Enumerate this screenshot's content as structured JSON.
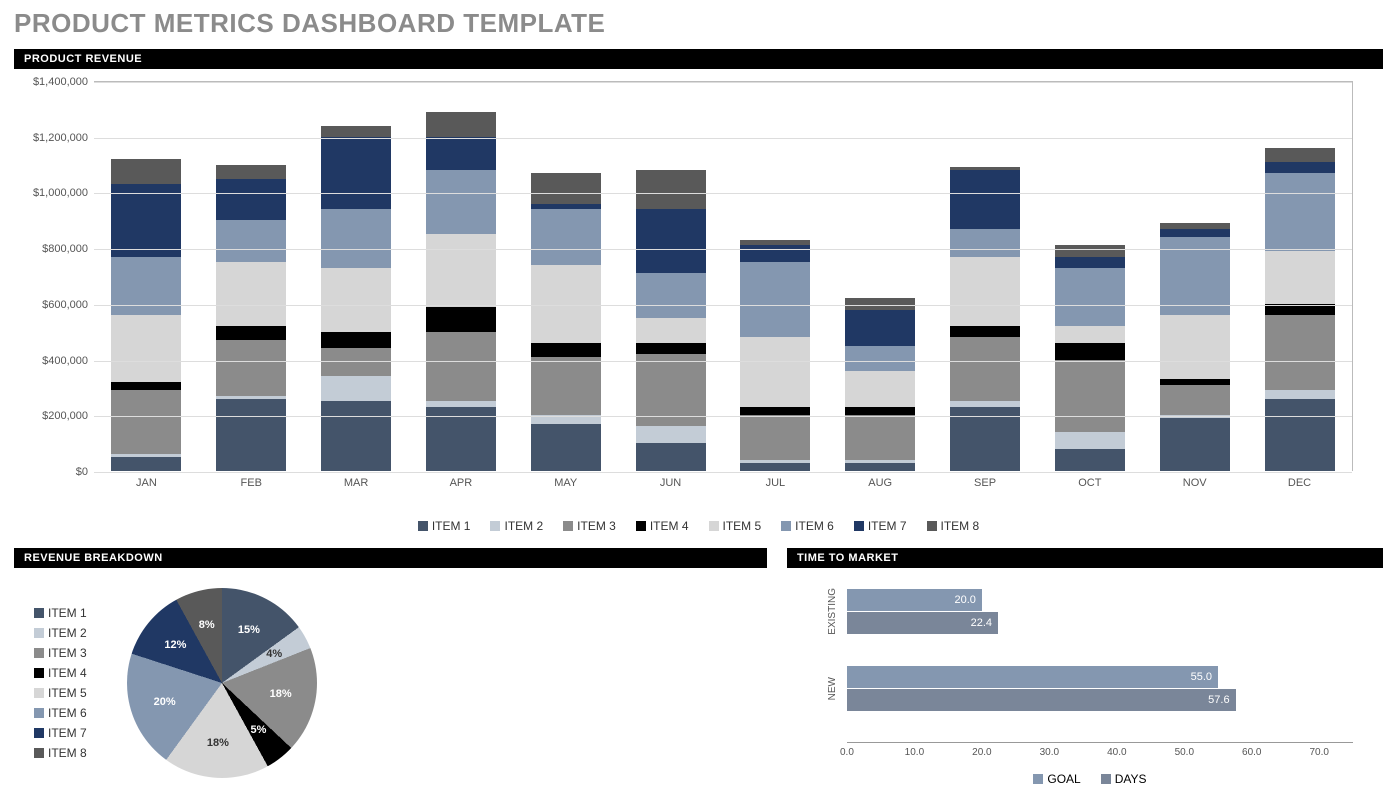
{
  "page_title": "PRODUCT METRICS DASHBOARD TEMPLATE",
  "sections": {
    "revenue": "PRODUCT REVENUE",
    "breakdown": "REVENUE BREAKDOWN",
    "ttm": "TIME TO MARKET"
  },
  "items": [
    "ITEM 1",
    "ITEM 2",
    "ITEM 3",
    "ITEM 4",
    "ITEM 5",
    "ITEM 6",
    "ITEM 7",
    "ITEM 8"
  ],
  "ttm_legend": {
    "goal": "GOAL",
    "days": "DAYS"
  },
  "chart_data": [
    {
      "id": "product_revenue",
      "type": "bar",
      "stacked": true,
      "title": "PRODUCT REVENUE",
      "xlabel": "",
      "ylabel": "",
      "categories": [
        "JAN",
        "FEB",
        "MAR",
        "APR",
        "MAY",
        "JUN",
        "JUL",
        "AUG",
        "SEP",
        "OCT",
        "NOV",
        "DEC"
      ],
      "ylim": [
        0,
        1400000
      ],
      "yticks": [
        0,
        200000,
        400000,
        600000,
        800000,
        1000000,
        1200000,
        1400000
      ],
      "ytick_labels": [
        "$0",
        "$200,000",
        "$400,000",
        "$600,000",
        "$800,000",
        "$1,000,000",
        "$1,200,000",
        "$1,400,000"
      ],
      "series": [
        {
          "name": "ITEM 1",
          "values": [
            50000,
            260000,
            250000,
            230000,
            170000,
            100000,
            30000,
            30000,
            230000,
            80000,
            190000,
            260000
          ]
        },
        {
          "name": "ITEM 2",
          "values": [
            10000,
            10000,
            90000,
            20000,
            30000,
            60000,
            10000,
            10000,
            20000,
            60000,
            10000,
            30000
          ]
        },
        {
          "name": "ITEM 3",
          "values": [
            230000,
            200000,
            100000,
            250000,
            210000,
            260000,
            160000,
            160000,
            230000,
            260000,
            110000,
            270000
          ]
        },
        {
          "name": "ITEM 4",
          "values": [
            30000,
            50000,
            60000,
            90000,
            50000,
            40000,
            30000,
            30000,
            40000,
            60000,
            20000,
            40000
          ]
        },
        {
          "name": "ITEM 5",
          "values": [
            240000,
            230000,
            230000,
            260000,
            280000,
            90000,
            250000,
            130000,
            250000,
            60000,
            230000,
            190000
          ]
        },
        {
          "name": "ITEM 6",
          "values": [
            210000,
            150000,
            210000,
            230000,
            200000,
            160000,
            270000,
            90000,
            100000,
            210000,
            280000,
            280000
          ]
        },
        {
          "name": "ITEM 7",
          "values": [
            260000,
            150000,
            260000,
            120000,
            20000,
            230000,
            60000,
            130000,
            210000,
            40000,
            30000,
            40000
          ]
        },
        {
          "name": "ITEM 8",
          "values": [
            90000,
            50000,
            40000,
            90000,
            110000,
            140000,
            20000,
            40000,
            10000,
            40000,
            20000,
            50000
          ]
        }
      ]
    },
    {
      "id": "revenue_breakdown",
      "type": "pie",
      "title": "REVENUE BREAKDOWN",
      "labels": [
        "ITEM 1",
        "ITEM 2",
        "ITEM 3",
        "ITEM 4",
        "ITEM 5",
        "ITEM 6",
        "ITEM 7",
        "ITEM 8"
      ],
      "values": [
        15,
        4,
        18,
        5,
        18,
        20,
        12,
        8
      ],
      "value_labels": [
        "15%",
        "4%",
        "18%",
        "5%",
        "18%",
        "20%",
        "12%",
        "8%"
      ]
    },
    {
      "id": "time_to_market",
      "type": "bar",
      "orientation": "horizontal",
      "grouped": true,
      "title": "TIME TO MARKET",
      "categories": [
        "EXISTING",
        "NEW"
      ],
      "xlim": [
        0,
        75
      ],
      "xticks": [
        0,
        10,
        20,
        30,
        40,
        50,
        60,
        70
      ],
      "xtick_labels": [
        "0.0",
        "10.0",
        "20.0",
        "30.0",
        "40.0",
        "50.0",
        "60.0",
        "70.0"
      ],
      "series": [
        {
          "name": "GOAL",
          "values": [
            20.0,
            55.0
          ]
        },
        {
          "name": "DAYS",
          "values": [
            22.4,
            57.6
          ]
        }
      ]
    }
  ]
}
